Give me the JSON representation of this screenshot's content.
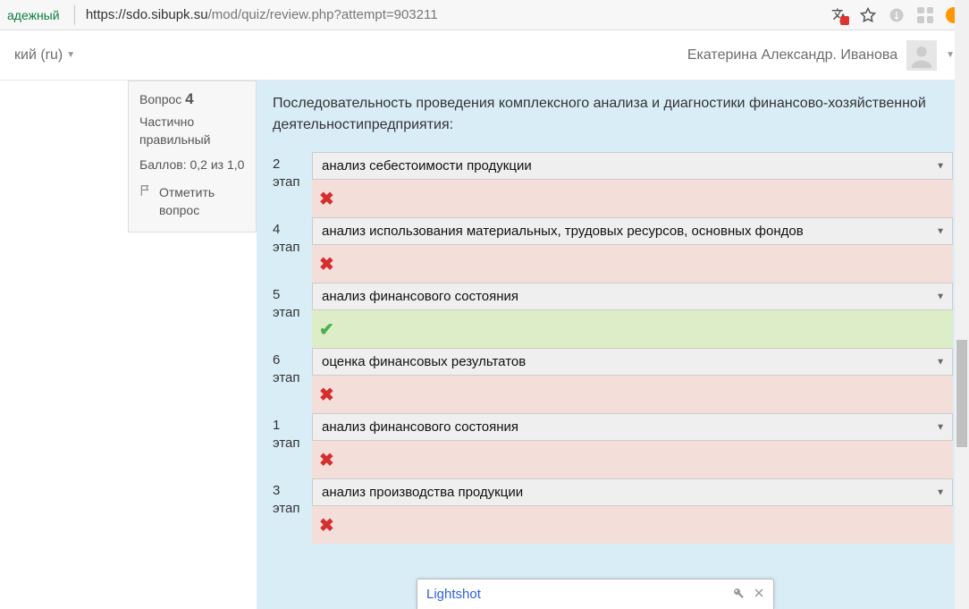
{
  "browser": {
    "security_label": "адежный",
    "url_domain": "https://sdo.sibupk.su",
    "url_path": "/mod/quiz/review.php?attempt=903211"
  },
  "site": {
    "lang_label": "кий (ru)",
    "user_name": "Екатерина Александр. Иванова"
  },
  "question_block": {
    "label": "Вопрос",
    "number": "4",
    "state": "Частично правильный",
    "marks": "Баллов: 0,2 из 1,0",
    "flag_label": "Отметить вопрос"
  },
  "question": {
    "text": "Последовательность проведения комплексного анализа и диагностики финансово-хозяйственной деятельностипредприятия:",
    "rows": [
      {
        "label_num": "2",
        "label_word": "этап",
        "selected": "анализ себестоимости продукции",
        "result": "wrong"
      },
      {
        "label_num": "4",
        "label_word": "этап",
        "selected": "анализ использования материальных, трудовых ресурсов, основных фондов",
        "result": "wrong"
      },
      {
        "label_num": "5",
        "label_word": "этап",
        "selected": "анализ финансового состояния",
        "result": "right"
      },
      {
        "label_num": "6",
        "label_word": "этап",
        "selected": "оценка финансовых результатов",
        "result": "wrong"
      },
      {
        "label_num": "1",
        "label_word": "этап",
        "selected": "анализ финансового состояния",
        "result": "wrong"
      },
      {
        "label_num": "3",
        "label_word": "этап",
        "selected": "анализ производства продукции",
        "result": "wrong"
      }
    ]
  },
  "lightshot": {
    "title": "Lightshot"
  }
}
